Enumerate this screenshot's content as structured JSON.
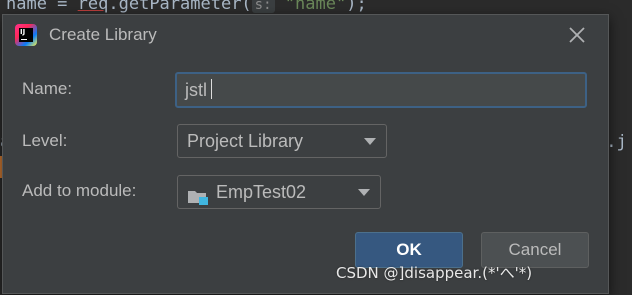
{
  "background_code": {
    "line_top_prefix": "name = ",
    "line_top_req": "req",
    "line_top_method": ".getParameter(",
    "line_top_hint": "s:",
    "line_top_string": "\"name\"",
    "line_top_suffix": ");",
    "right_fragment": "m.j",
    "left_fragment": "a"
  },
  "dialog": {
    "title": "Create Library",
    "app_icon": "intellij-idea-icon",
    "close_icon": "close-icon"
  },
  "form": {
    "name_label": "Name:",
    "name_value": "jstl",
    "level_label": "Level:",
    "level_value": "Project Library",
    "module_label": "Add to module:",
    "module_value": "EmpTest02",
    "module_icon": "module-folder-icon"
  },
  "buttons": {
    "ok_label": "OK",
    "cancel_label": "Cancel"
  },
  "watermark": "CSDN @]disappear.(*'へ'*)",
  "colors": {
    "dialog_bg": "#3c3f41",
    "focus_border": "#3d6185",
    "ok_bg": "#365880",
    "cancel_bg": "#4c5052",
    "text": "#bbbbbb"
  }
}
